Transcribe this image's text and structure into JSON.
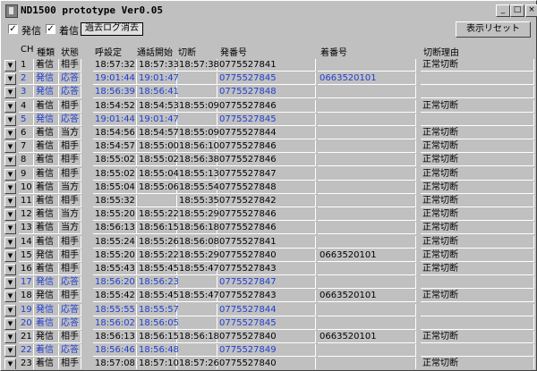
{
  "window": {
    "title": "ND1500 prototype Ver0.05",
    "controls": [
      "_",
      "□",
      "×"
    ]
  },
  "toolbar": {
    "check_outgoing": {
      "label": "発信",
      "checked": true
    },
    "check_incoming": {
      "label": "着信",
      "checked": true
    },
    "erase_log_label": "過去ログ消去",
    "reset_display_label": "表示リセット"
  },
  "table": {
    "columns": [
      "CH",
      "種類",
      "状態",
      "呼設定",
      "通話開始",
      "切断",
      "発番号",
      "着番号",
      "切断理由"
    ],
    "rows": [
      {
        "ch": "1",
        "type": "着信",
        "state": "相手",
        "set": "18:57:32",
        "start": "18:57:33",
        "cut": "18:57:38",
        "from": "0775527841",
        "to": "",
        "reason": "正常切断",
        "blue": false
      },
      {
        "ch": "2",
        "type": "発信",
        "state": "応答",
        "set": "19:01:44",
        "start": "19:01:47",
        "cut": "",
        "from": "0775527845",
        "to": "0663520101",
        "reason": "",
        "blue": true
      },
      {
        "ch": "3",
        "type": "発信",
        "state": "応答",
        "set": "18:56:39",
        "start": "18:56:41",
        "cut": "",
        "from": "0775527848",
        "to": "",
        "reason": "",
        "blue": true
      },
      {
        "ch": "4",
        "type": "着信",
        "state": "相手",
        "set": "18:54:52",
        "start": "18:54:53",
        "cut": "18:55:09",
        "from": "0775527846",
        "to": "",
        "reason": "正常切断",
        "blue": false
      },
      {
        "ch": "5",
        "type": "発信",
        "state": "応答",
        "set": "19:01:44",
        "start": "19:01:47",
        "cut": "",
        "from": "0775527845",
        "to": "",
        "reason": "",
        "blue": true
      },
      {
        "ch": "6",
        "type": "着信",
        "state": "当方",
        "set": "18:54:56",
        "start": "18:54:57",
        "cut": "18:55:09",
        "from": "0775527844",
        "to": "",
        "reason": "正常切断",
        "blue": false
      },
      {
        "ch": "7",
        "type": "着信",
        "state": "相手",
        "set": "18:54:57",
        "start": "18:55:00",
        "cut": "18:56:10",
        "from": "0775527846",
        "to": "",
        "reason": "正常切断",
        "blue": false
      },
      {
        "ch": "8",
        "type": "着信",
        "state": "相手",
        "set": "18:55:02",
        "start": "18:55:02",
        "cut": "18:56:38",
        "from": "0775527846",
        "to": "",
        "reason": "正常切断",
        "blue": false
      },
      {
        "ch": "9",
        "type": "着信",
        "state": "相手",
        "set": "18:55:02",
        "start": "18:55:04",
        "cut": "18:55:13",
        "from": "0775527847",
        "to": "",
        "reason": "正常切断",
        "blue": false
      },
      {
        "ch": "10",
        "type": "着信",
        "state": "当方",
        "set": "18:55:04",
        "start": "18:55:06",
        "cut": "18:55:54",
        "from": "0775527848",
        "to": "",
        "reason": "正常切断",
        "blue": false
      },
      {
        "ch": "11",
        "type": "着信",
        "state": "相手",
        "set": "18:55:32",
        "start": "",
        "cut": "18:55:35",
        "from": "0775527842",
        "to": "",
        "reason": "正常切断",
        "blue": false
      },
      {
        "ch": "12",
        "type": "着信",
        "state": "当方",
        "set": "18:55:20",
        "start": "18:55:22",
        "cut": "18:55:29",
        "from": "0775527846",
        "to": "",
        "reason": "正常切断",
        "blue": false
      },
      {
        "ch": "13",
        "type": "着信",
        "state": "当方",
        "set": "18:56:13",
        "start": "18:56:15",
        "cut": "18:56:18",
        "from": "0775527846",
        "to": "",
        "reason": "正常切断",
        "blue": false
      },
      {
        "ch": "14",
        "type": "着信",
        "state": "相手",
        "set": "18:55:24",
        "start": "18:55:26",
        "cut": "18:56:08",
        "from": "0775527841",
        "to": "",
        "reason": "正常切断",
        "blue": false
      },
      {
        "ch": "15",
        "type": "発信",
        "state": "相手",
        "set": "18:55:20",
        "start": "18:55:22",
        "cut": "18:55:29",
        "from": "0775527840",
        "to": "0663520101",
        "reason": "正常切断",
        "blue": false
      },
      {
        "ch": "16",
        "type": "着信",
        "state": "相手",
        "set": "18:55:43",
        "start": "18:55:45",
        "cut": "18:55:47",
        "from": "0775527843",
        "to": "",
        "reason": "正常切断",
        "blue": false
      },
      {
        "ch": "17",
        "type": "発信",
        "state": "応答",
        "set": "18:56:20",
        "start": "18:56:23",
        "cut": "",
        "from": "0775527847",
        "to": "",
        "reason": "",
        "blue": true
      },
      {
        "ch": "18",
        "type": "発信",
        "state": "相手",
        "set": "18:55:42",
        "start": "18:55:45",
        "cut": "18:55:47",
        "from": "0775527843",
        "to": "0663520101",
        "reason": "正常切断",
        "blue": false
      },
      {
        "ch": "19",
        "type": "発信",
        "state": "応答",
        "set": "18:55:55",
        "start": "18:55:57",
        "cut": "",
        "from": "0775527844",
        "to": "",
        "reason": "",
        "blue": true
      },
      {
        "ch": "20",
        "type": "着信",
        "state": "応答",
        "set": "18:56:02",
        "start": "18:56:05",
        "cut": "",
        "from": "0775527845",
        "to": "",
        "reason": "",
        "blue": true
      },
      {
        "ch": "21",
        "type": "発信",
        "state": "相手",
        "set": "18:56:13",
        "start": "18:56:15",
        "cut": "18:56:18",
        "from": "0775527840",
        "to": "0663520101",
        "reason": "正常切断",
        "blue": false
      },
      {
        "ch": "22",
        "type": "着信",
        "state": "応答",
        "set": "18:56:46",
        "start": "18:56:48",
        "cut": "",
        "from": "0775527849",
        "to": "",
        "reason": "",
        "blue": true
      },
      {
        "ch": "23",
        "type": "着信",
        "state": "相手",
        "set": "18:57:08",
        "start": "18:57:10",
        "cut": "18:57:26",
        "from": "0775527840",
        "to": "",
        "reason": "正常切断",
        "blue": false
      }
    ]
  }
}
